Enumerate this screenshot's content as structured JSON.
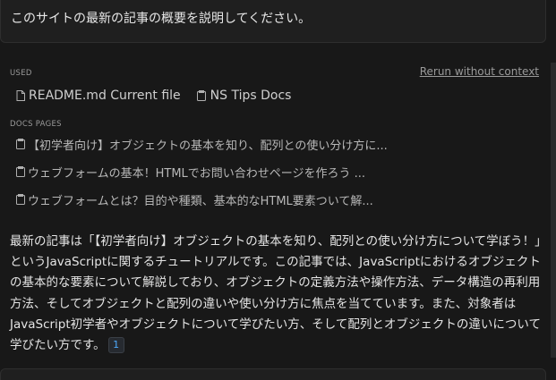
{
  "user_message": {
    "text": "このサイトの最新の記事の概要を説明してください。"
  },
  "used": {
    "label": "USED",
    "rerun_label": "Rerun without context",
    "items": [
      {
        "label": "README.md Current file",
        "icon": "file-icon"
      },
      {
        "label": "NS Tips Docs",
        "icon": "docs-icon"
      }
    ]
  },
  "docs_pages": {
    "label": "DOCS PAGES",
    "items": [
      {
        "label": "【初学者向け】オブジェクトの基本を知り、配列との使い分け方に...",
        "icon": "docs-icon"
      },
      {
        "label": "ウェブフォームの基本！HTMLでお問い合わせページを作ろう ...",
        "icon": "docs-icon"
      },
      {
        "label": "ウェブフォームとは？目的や種類、基本的なHTML要素ついて解...",
        "icon": "docs-icon"
      }
    ]
  },
  "answer": {
    "text": "最新の記事は「【初学者向け】オブジェクトの基本を知り、配列との使い分け方について学ぼう！」というJavaScriptに関するチュートリアルです。この記事では、JavaScriptにおけるオブジェクトの基本的な要素について解説しており、オブジェクトの定義方法や操作方法、データ構造の再利用方法、そしてオブジェクトと配列の違いや使い分け方に焦点を当てています。また、対象者はJavaScript初学者やオブジェクトについて学びたい方、そして配列とオブジェクトの違いについて学びたい方です。",
    "citation": "1"
  }
}
